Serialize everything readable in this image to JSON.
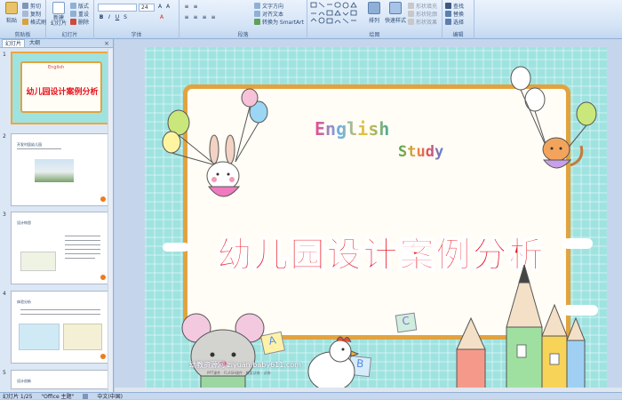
{
  "ribbon": {
    "clipboard": {
      "label": "剪贴板",
      "paste": "粘贴",
      "cut": "剪切",
      "copy": "复制",
      "format_painter": "格式刷"
    },
    "slides": {
      "label": "幻灯片",
      "new_slide": "新建\n幻灯片",
      "layout": "版式",
      "reset": "重设",
      "delete": "删除"
    },
    "font": {
      "label": "字体",
      "font_size": "24"
    },
    "paragraph": {
      "label": "段落",
      "text_direction": "文字方向",
      "align_text": "对齐文本",
      "smartart": "转换为 SmartArt"
    },
    "drawing": {
      "label": "绘图",
      "arrange": "排列",
      "quick_styles": "快速样式",
      "shape_fill": "形状填充",
      "shape_outline": "形状轮廓",
      "shape_effects": "形状效果"
    },
    "editing": {
      "label": "编辑",
      "find": "查找",
      "replace": "替换",
      "select": "选择"
    }
  },
  "pane_tabs": {
    "slides": "幻灯片",
    "outline": "大纲"
  },
  "thumbnails": [
    {
      "num": "1",
      "title": "幼儿园设计案例分析"
    },
    {
      "num": "2",
      "title": "开发村居幼儿园"
    },
    {
      "num": "3",
      "title": "设计构思"
    },
    {
      "num": "4",
      "title": "体验分析"
    },
    {
      "num": "5",
      "title": "设计创新"
    }
  ],
  "slide": {
    "english": "English",
    "study": "Study",
    "title": "幼儿园设计案例分析",
    "credit": "幼教资源网 ziyuan.baby611.com",
    "credit_small": "PPT课件 · FLASH课件 · 教案试卷 · 试卷"
  },
  "status": {
    "slide_count": "幻灯片 1/25",
    "theme": "\"Office 主题\"",
    "language": "中文(中国)"
  },
  "colors": {
    "title": "#e8141e",
    "frame": "#e2a33f",
    "bg": "#9fe3e0",
    "selected": "#f2a43a"
  }
}
